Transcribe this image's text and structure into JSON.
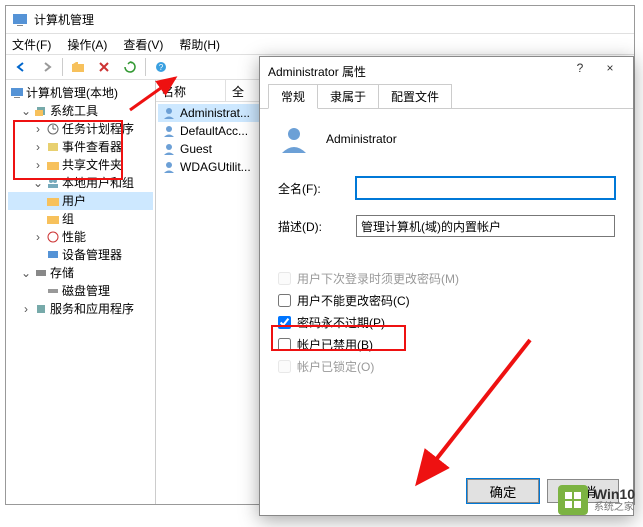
{
  "app": {
    "title": "计算机管理",
    "menu": [
      "文件(F)",
      "操作(A)",
      "查看(V)",
      "帮助(H)"
    ]
  },
  "tree": {
    "root": "计算机管理(本地)",
    "sys_tools": "系统工具",
    "task_scheduler": "任务计划程序",
    "event_viewer": "事件查看器",
    "shared_folders": "共享文件夹",
    "local_users": "本地用户和组",
    "users": "用户",
    "groups": "组",
    "performance": "性能",
    "device_mgr": "设备管理器",
    "storage": "存储",
    "disk_mgmt": "磁盘管理",
    "services_apps": "服务和应用程序"
  },
  "list": {
    "col_name": "名称",
    "col_full": "全",
    "items": [
      "Administrat...",
      "DefaultAcc...",
      "Guest",
      "WDAGUtilit..."
    ]
  },
  "dialog": {
    "title": "Administrator 属性",
    "help": "?",
    "close": "×",
    "tabs": [
      "常规",
      "隶属于",
      "配置文件"
    ],
    "header_name": "Administrator",
    "fullname_label": "全名(F):",
    "fullname_value": "",
    "desc_label": "描述(D):",
    "desc_value": "管理计算机(域)的内置帐户",
    "chk_change_next": "用户下次登录时须更改密码(M)",
    "chk_cannot_change": "用户不能更改密码(C)",
    "chk_never_expire": "密码永不过期(P)",
    "chk_disabled": "帐户已禁用(B)",
    "chk_locked": "帐户已锁定(O)",
    "ok": "确定",
    "cancel": "取消"
  },
  "watermark": {
    "line1": "Win10",
    "line2": "系统之家"
  }
}
